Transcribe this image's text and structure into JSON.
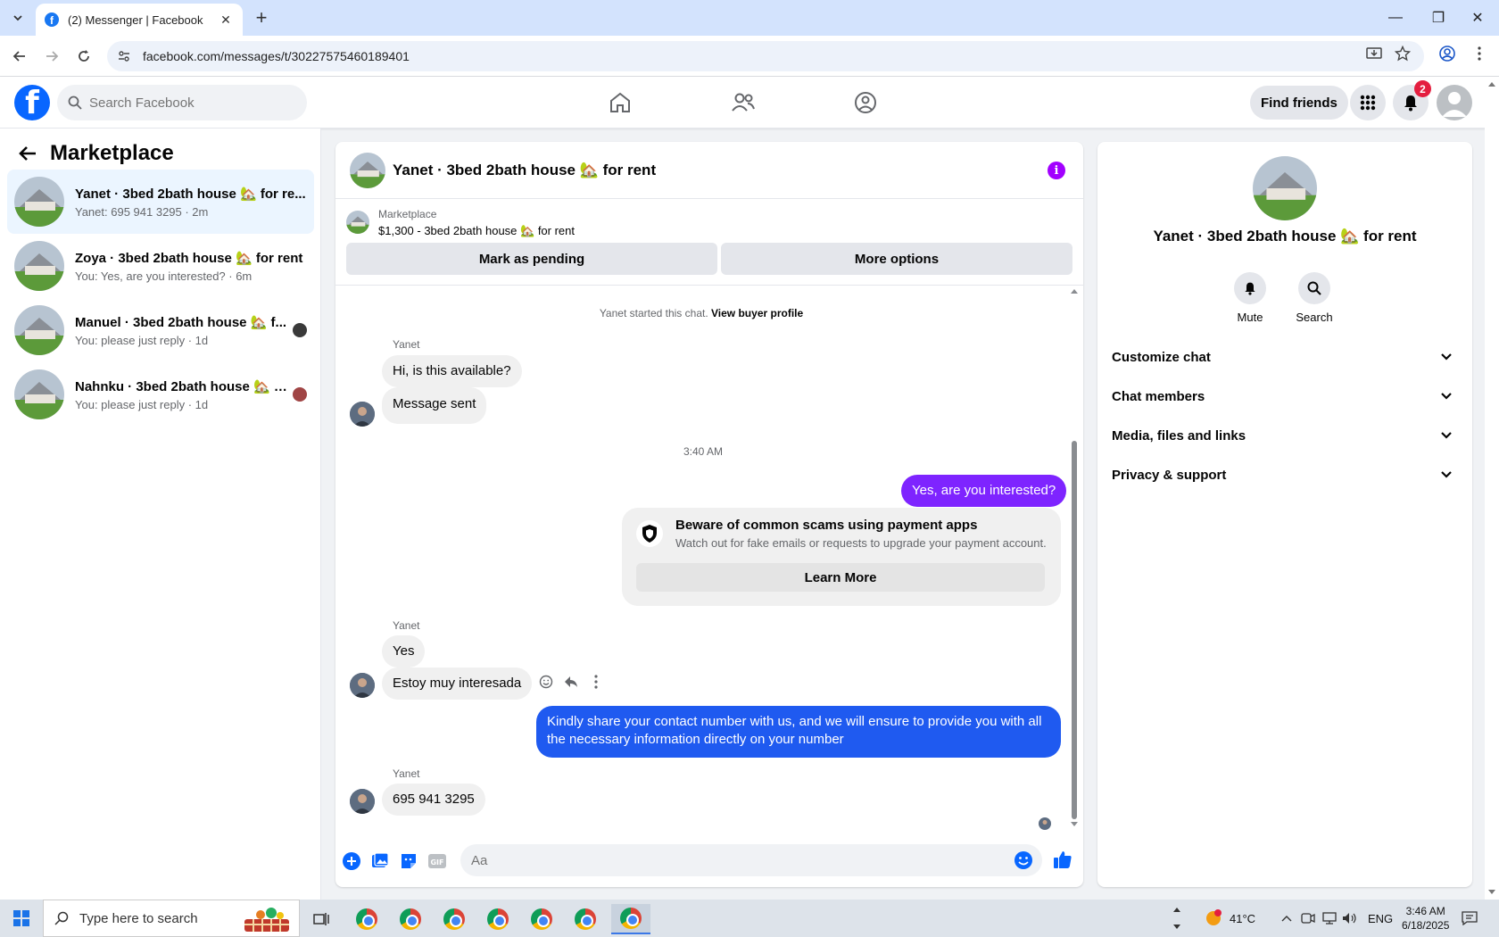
{
  "browser": {
    "tab_title": "(2) Messenger | Facebook",
    "url": "facebook.com/messages/t/30227575460189401"
  },
  "fb": {
    "search_placeholder": "Search Facebook",
    "find_friends": "Find friends",
    "notif_count": "2"
  },
  "sidebar": {
    "title": "Marketplace",
    "conversations": [
      {
        "title": "Yanet · 3bed 2bath house 🏡 for re...",
        "sub": "Yanet: 695 941 3295 · 2m"
      },
      {
        "title": "Zoya · 3bed 2bath house 🏡 for rent",
        "sub": "You: Yes, are you interested? · 6m"
      },
      {
        "title": "Manuel · 3bed 2bath house 🏡 f...",
        "sub": "You: please just reply · 1d"
      },
      {
        "title": "Nahnku · 3bed 2bath house 🏡 f...",
        "sub": "You: please just reply · 1d"
      }
    ]
  },
  "chat": {
    "title": "Yanet · 3bed 2bath house 🏡 for rent",
    "listing_category": "Marketplace",
    "listing_name": "$1,300 - 3bed 2bath house 🏡 for rent",
    "mark_pending": "Mark as pending",
    "more_options": "More options",
    "sys_note": "Yanet started this chat.",
    "sys_link": "View buyer profile",
    "sender": "Yanet",
    "m1": "Hi, is this available?",
    "m2": "Message sent",
    "time": "3:40 AM",
    "m3": "Yes, are you interested?",
    "scam_title": "Beware of common scams using payment apps",
    "scam_sub": "Watch out for fake emails or requests to upgrade your payment account.",
    "scam_btn": "Learn More",
    "m4": "Yes",
    "m5": "Estoy muy interesada",
    "m6": "Kindly share your contact number with us, and we will ensure to provide you with all the necessary information directly on your number",
    "m7": "695 941 3295",
    "composer_placeholder": "Aa"
  },
  "rpanel": {
    "title": "Yanet · 3bed 2bath house 🏡 for rent",
    "mute": "Mute",
    "search": "Search",
    "rows": [
      "Customize chat",
      "Chat members",
      "Media, files and links",
      "Privacy & support"
    ]
  },
  "taskbar": {
    "search": "Type here to search",
    "temp": "41°C",
    "lang": "ENG",
    "time": "3:46 AM",
    "date": "6/18/2025"
  },
  "colors": {
    "fb_blue": "#0866ff",
    "outgoing_purple": "#7e24ff",
    "outgoing_blue": "#1f5af0"
  }
}
